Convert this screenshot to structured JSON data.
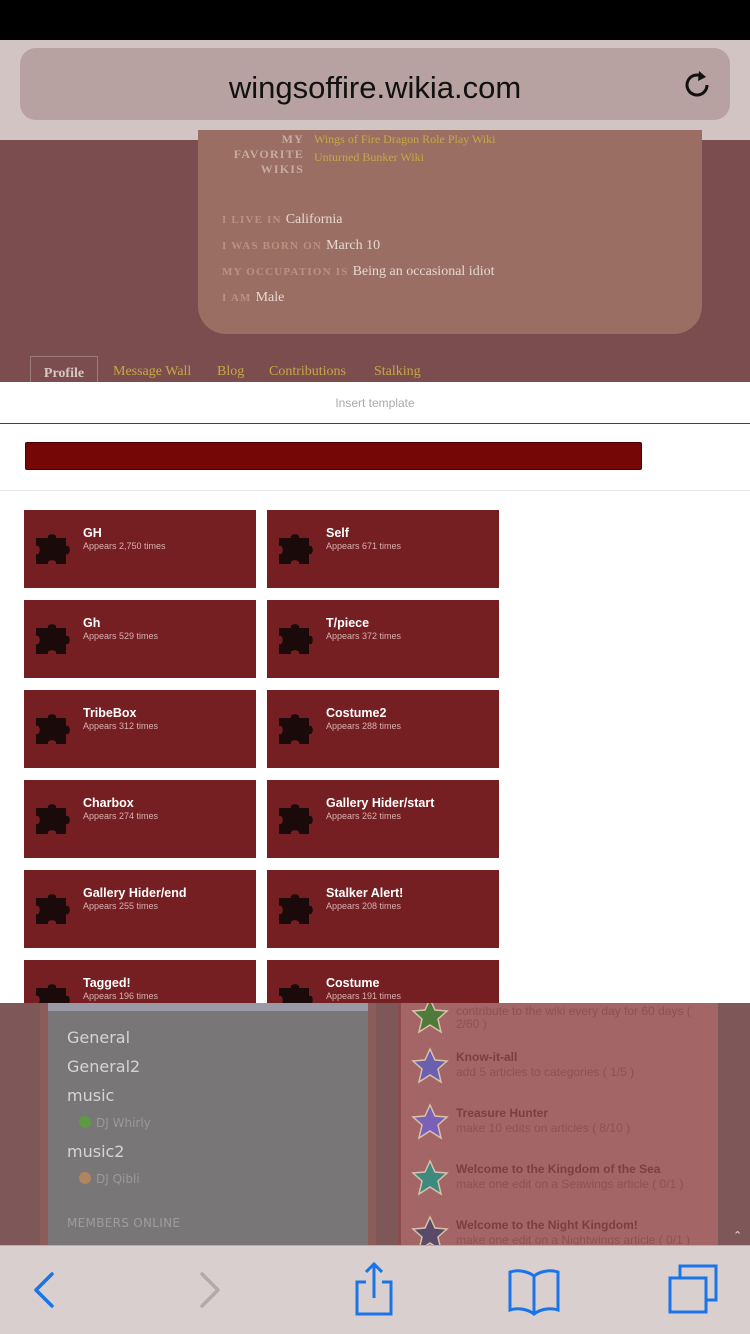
{
  "browser": {
    "url": "wingsoffire.wikia.com",
    "reload_icon": "reload-icon"
  },
  "profile": {
    "favorite_wikis_label": "MY FAVORITE WIKIS",
    "favorite_wikis_label_lines": [
      "MY",
      "FAVORITE",
      "WIKIS"
    ],
    "favorite_wikis": [
      "Wings of Fire Dragon Role Play Wiki",
      "Unturned Bunker Wiki"
    ],
    "details": [
      {
        "label": "I LIVE IN",
        "value": "California"
      },
      {
        "label": "I WAS BORN ON",
        "value": "March 10"
      },
      {
        "label": "MY OCCUPATION IS",
        "value": "Being an occasional idiot"
      },
      {
        "label": "I AM",
        "value": "Male"
      }
    ],
    "tabs": [
      "Profile",
      "Message Wall",
      "Blog",
      "Contributions",
      "Stalking"
    ],
    "active_tab": "Profile"
  },
  "template_panel": {
    "title": "Insert template",
    "search_value": "",
    "search_icon": "search-icon",
    "templates": [
      {
        "name": "GH",
        "count": "Appears 2,750 times"
      },
      {
        "name": "Self",
        "count": "Appears 671 times"
      },
      {
        "name": "Gh",
        "count": "Appears 529 times"
      },
      {
        "name": "T/piece",
        "count": "Appears 372 times"
      },
      {
        "name": "TribeBox",
        "count": "Appears 312 times"
      },
      {
        "name": "Costume2",
        "count": "Appears 288 times"
      },
      {
        "name": "Charbox",
        "count": "Appears 274 times"
      },
      {
        "name": "Gallery Hider/start",
        "count": "Appears 262 times"
      },
      {
        "name": "Gallery Hider/end",
        "count": "Appears 255 times"
      },
      {
        "name": "Stalker Alert!",
        "count": "Appears 208 times"
      },
      {
        "name": "Tagged!",
        "count": "Appears 196 times"
      },
      {
        "name": "Costume",
        "count": "Appears 191 times"
      }
    ]
  },
  "chat": {
    "channels": [
      {
        "name": "General",
        "users": []
      },
      {
        "name": "General2",
        "users": []
      },
      {
        "name": "music",
        "users": [
          "DJ Whirly"
        ]
      },
      {
        "name": "music2",
        "users": [
          "DJ Qibli"
        ]
      }
    ],
    "members_online_label": "MEMBERS ONLINE"
  },
  "achievements": [
    {
      "title": "",
      "desc": "contribute to the wiki every day for 60 days (",
      "desc2": "2/60 )",
      "color": "#4f7a3a"
    },
    {
      "title": "Know-it-all",
      "desc": "add 5 articles to categories ( 1/5 )",
      "color": "#6b5fb0"
    },
    {
      "title": "Treasure Hunter",
      "desc": "make 10 edits on articles ( 8/10 )",
      "color": "#7a60b8"
    },
    {
      "title": "Welcome to the Kingdom of the Sea",
      "desc": "make one edit on a Seawings article ( 0/1 )",
      "color": "#3f8a80"
    },
    {
      "title": "Welcome to the Night Kingdom!",
      "desc": "make one edit on a Nightwings article ( 0/1 )",
      "color": "#5a4a6a"
    }
  ],
  "toolbar": {
    "items": [
      "back-icon",
      "forward-icon",
      "share-icon",
      "bookmarks-icon",
      "tabs-icon"
    ]
  },
  "colors": {
    "accent": "#1a74e8",
    "template_tile": "#751f22",
    "search_bg": "#760707"
  }
}
